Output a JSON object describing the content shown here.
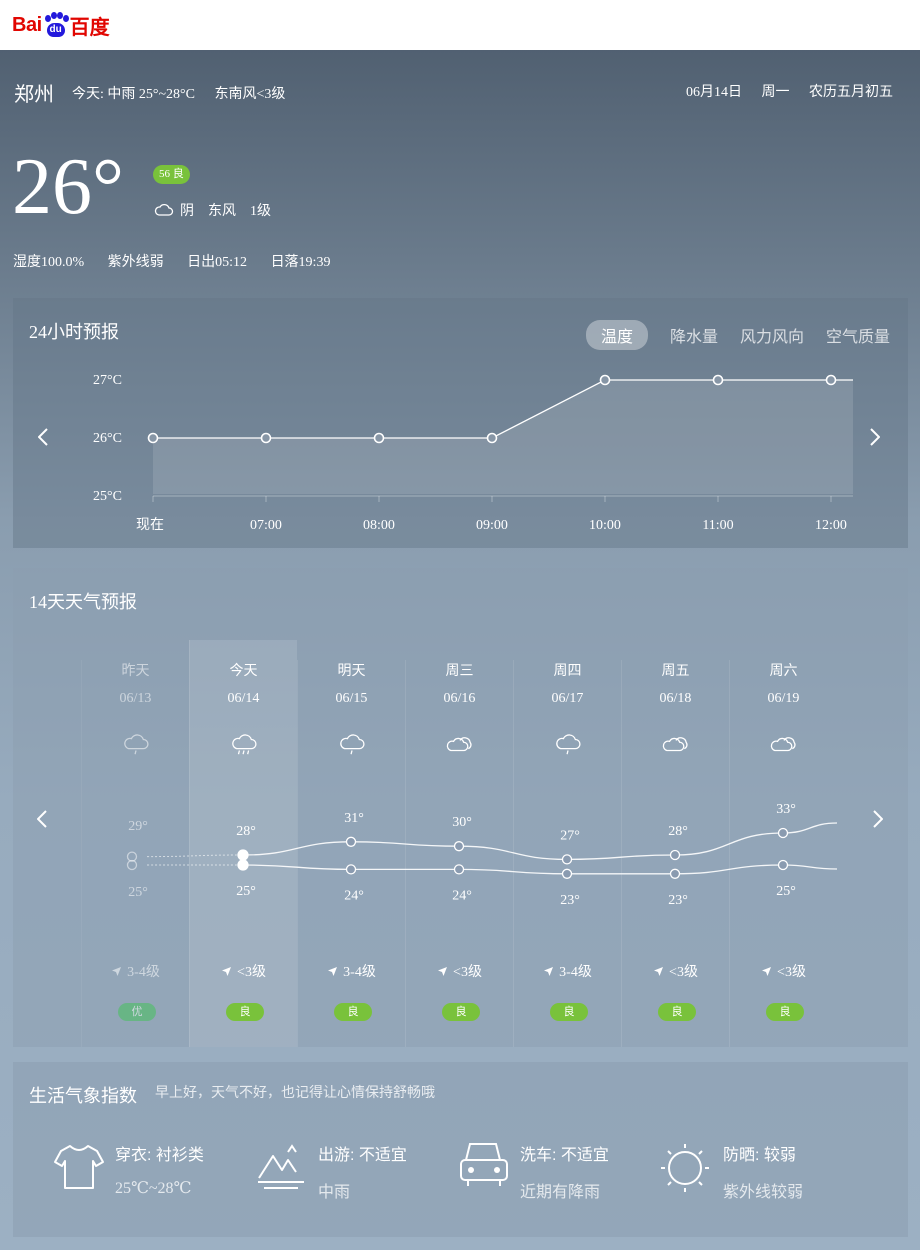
{
  "header": {
    "logo_text_left": "Bai",
    "logo_text_paw": "du",
    "logo_text_right": "百度"
  },
  "current": {
    "city": "郑州",
    "today_summary": "今天: 中雨 25°~28°C",
    "today_wind": "东南风<3级",
    "date": "06月14日",
    "weekday": "周一",
    "lunar": "农历五月初五",
    "temperature": "26°",
    "aqi": "56 良",
    "condition": "阴",
    "wind_dir": "东风",
    "wind_level": "1级",
    "humidity": "湿度100.0%",
    "uv": "紫外线弱",
    "sunrise": "日出05:12",
    "sunset": "日落19:39"
  },
  "hourly": {
    "title": "24小时预报",
    "tabs": [
      "温度",
      "降水量",
      "风力风向",
      "空气质量"
    ],
    "active_tab": 0,
    "y_ticks": [
      "27°C",
      "26°C",
      "25°C"
    ],
    "times": [
      "现在",
      "07:00",
      "08:00",
      "09:00",
      "10:00",
      "11:00",
      "12:00"
    ]
  },
  "daily": {
    "title": "14天天气预报",
    "days": [
      {
        "name": "昨天",
        "date": "06/13",
        "high": "29°",
        "low": "25°",
        "wind": "3-4级",
        "aqi": "优",
        "icon": "light-rain-icon"
      },
      {
        "name": "今天",
        "date": "06/14",
        "high": "28°",
        "low": "25°",
        "wind": "<3级",
        "aqi": "良",
        "icon": "moderate-rain-icon"
      },
      {
        "name": "明天",
        "date": "06/15",
        "high": "31°",
        "low": "24°",
        "wind": "3-4级",
        "aqi": "良",
        "icon": "light-rain-icon"
      },
      {
        "name": "周三",
        "date": "06/16",
        "high": "30°",
        "low": "24°",
        "wind": "<3级",
        "aqi": "良",
        "icon": "cloudy-icon"
      },
      {
        "name": "周四",
        "date": "06/17",
        "high": "27°",
        "low": "23°",
        "wind": "3-4级",
        "aqi": "良",
        "icon": "light-rain-icon"
      },
      {
        "name": "周五",
        "date": "06/18",
        "high": "28°",
        "low": "23°",
        "wind": "<3级",
        "aqi": "良",
        "icon": "cloudy-icon"
      },
      {
        "name": "周六",
        "date": "06/19",
        "high": "33°",
        "low": "25°",
        "wind": "<3级",
        "aqi": "良",
        "icon": "cloudy-icon"
      }
    ]
  },
  "life": {
    "title": "生活气象指数",
    "subtitle": "早上好，天气不好，也记得让心情保持舒畅哦",
    "items": [
      {
        "label": "穿衣: 衬衫类",
        "desc": "25℃~28℃",
        "icon": "shirt-icon"
      },
      {
        "label": "出游: 不适宜",
        "desc": "中雨",
        "icon": "mountain-icon"
      },
      {
        "label": "洗车: 不适宜",
        "desc": "近期有降雨",
        "icon": "car-icon"
      },
      {
        "label": "防晒: 较弱",
        "desc": "紫外线较弱",
        "icon": "sun-icon"
      }
    ]
  },
  "chart_data": [
    {
      "type": "area",
      "x": [
        "现在",
        "07:00",
        "08:00",
        "09:00",
        "10:00",
        "11:00",
        "12:00"
      ],
      "series": [
        {
          "values": [
            26,
            26,
            26,
            26,
            27,
            27,
            27
          ]
        }
      ],
      "ylim": [
        25,
        27
      ],
      "yticks": [
        "27°C",
        "26°C",
        "25°C"
      ]
    },
    {
      "type": "line",
      "x": [
        "昨天",
        "今天",
        "明天",
        "周三",
        "周四",
        "周五",
        "周六"
      ],
      "series": [
        {
          "values": [
            29,
            28,
            31,
            30,
            27,
            28,
            33
          ]
        },
        {
          "values": [
            25,
            25,
            24,
            24,
            23,
            23,
            25
          ]
        }
      ]
    }
  ]
}
